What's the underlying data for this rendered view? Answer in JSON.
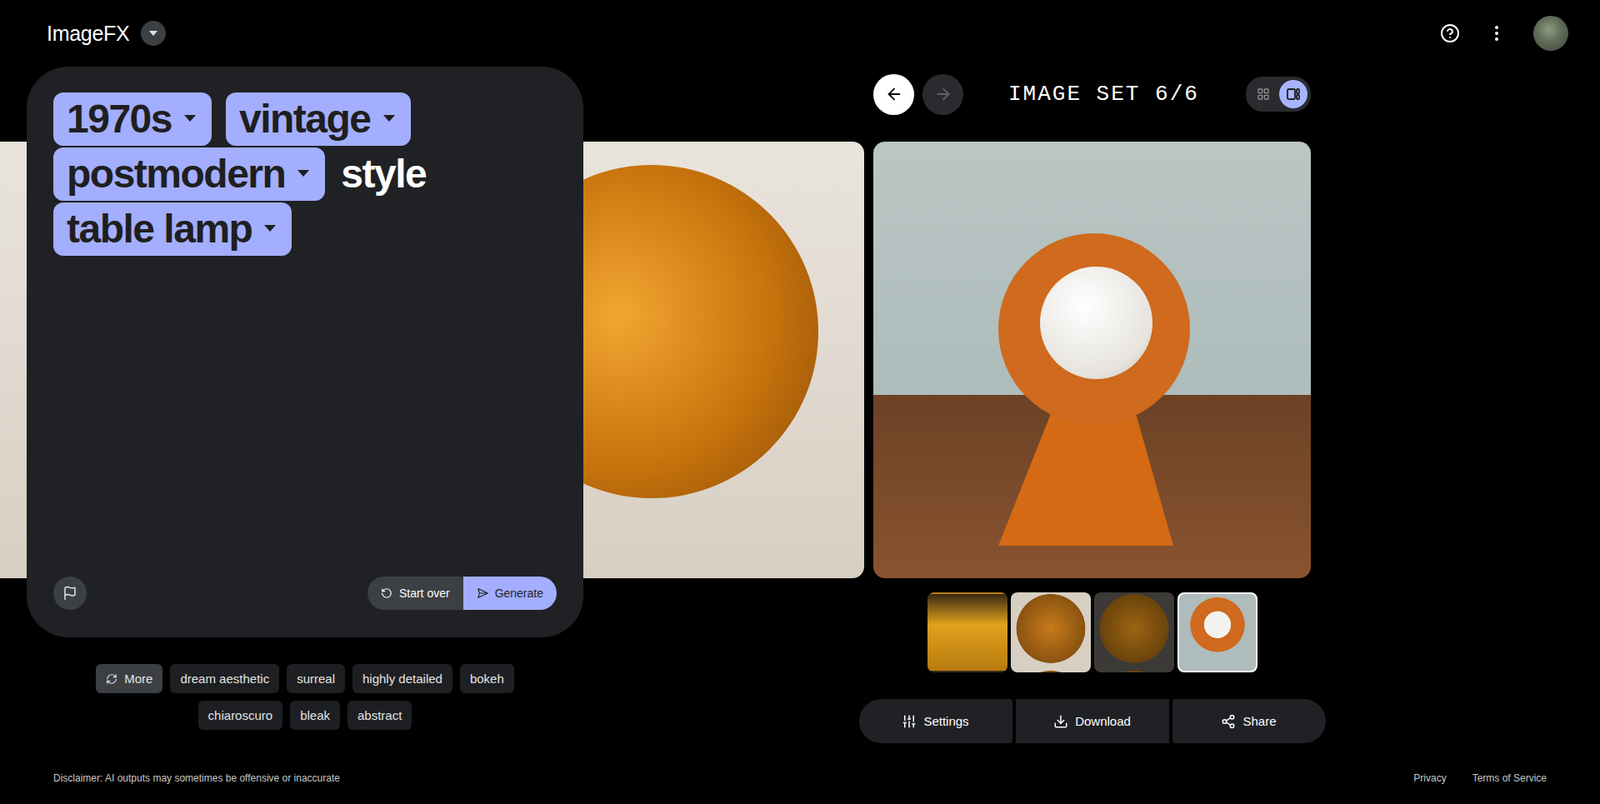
{
  "header": {
    "title": "ImageFX"
  },
  "prompt": {
    "tokens": [
      {
        "text": "1970s",
        "kind": "chip"
      },
      {
        "text": "vintage",
        "kind": "chip"
      },
      {
        "text": "postmodern",
        "kind": "chip"
      },
      {
        "text": "style",
        "kind": "text"
      },
      {
        "text": "table lamp",
        "kind": "chip"
      }
    ],
    "buttons": [
      "Start over",
      "Generate"
    ]
  },
  "suggestions": {
    "more": "More",
    "items": [
      "dream aesthetic",
      "surreal",
      "highly detailed",
      "bokeh",
      "chiaroscuro",
      "bleak",
      "abstract"
    ]
  },
  "gallery": {
    "label": "IMAGE SET 6/6",
    "back_disabled": false,
    "forward_disabled": true,
    "views": [
      {
        "kind": "grid",
        "selected": false
      },
      {
        "kind": "carousel",
        "selected": true
      }
    ],
    "thumbnails": [
      {
        "selected": false
      },
      {
        "selected": false
      },
      {
        "selected": false
      },
      {
        "selected": true
      }
    ]
  },
  "actions": [
    "Settings",
    "Download",
    "Share"
  ],
  "footer": {
    "disclaimer": "Disclaimer: AI outputs may sometimes be offensive or inaccurate",
    "links": [
      "Privacy",
      "Terms of Service"
    ]
  }
}
